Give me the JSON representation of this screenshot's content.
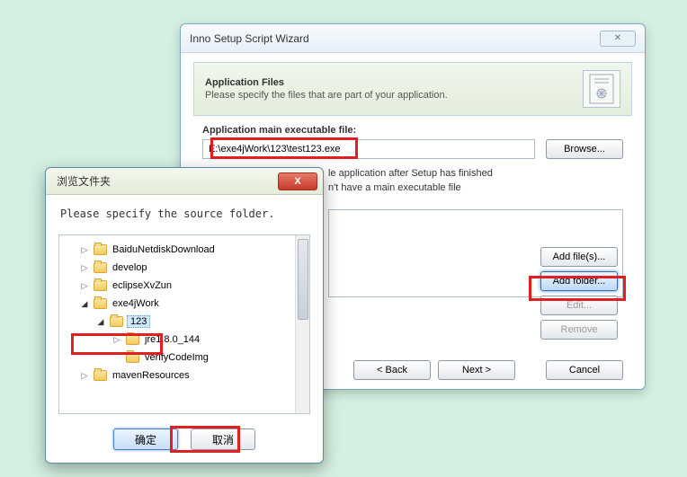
{
  "wizard": {
    "title": "Inno Setup Script Wizard",
    "header_title": "Application Files",
    "header_sub": "Please specify the files that are part of your application.",
    "exe_label": "Application main executable file:",
    "exe_path": "E:\\exe4jWork\\123\\test123.exe",
    "browse_label": "Browse...",
    "chk1_label": "le application after Setup has finished",
    "chk2_label": "n't have a main executable file",
    "btn_addfiles": "Add file(s)...",
    "btn_addfolder": "Add folder...",
    "btn_edit": "Edit...",
    "btn_remove": "Remove",
    "btn_back": "< Back",
    "btn_next": "Next >",
    "btn_cancel": "Cancel"
  },
  "browse": {
    "title": "浏览文件夹",
    "prompt": "Please specify the source folder.",
    "tree": [
      {
        "indent": 1,
        "arrow": "closed",
        "label": "BaiduNetdiskDownload"
      },
      {
        "indent": 1,
        "arrow": "closed",
        "label": "develop"
      },
      {
        "indent": 1,
        "arrow": "closed",
        "label": "eclipseXvZun"
      },
      {
        "indent": 1,
        "arrow": "open",
        "label": "exe4jWork"
      },
      {
        "indent": 2,
        "arrow": "open",
        "label": "123",
        "selected": true
      },
      {
        "indent": 3,
        "arrow": "closed",
        "label": "jre1.8.0_144"
      },
      {
        "indent": 3,
        "arrow": "none",
        "label": "verifyCodeImg"
      },
      {
        "indent": 1,
        "arrow": "closed",
        "label": "mavenResources"
      }
    ],
    "btn_ok": "确定",
    "btn_cancel": "取消"
  }
}
